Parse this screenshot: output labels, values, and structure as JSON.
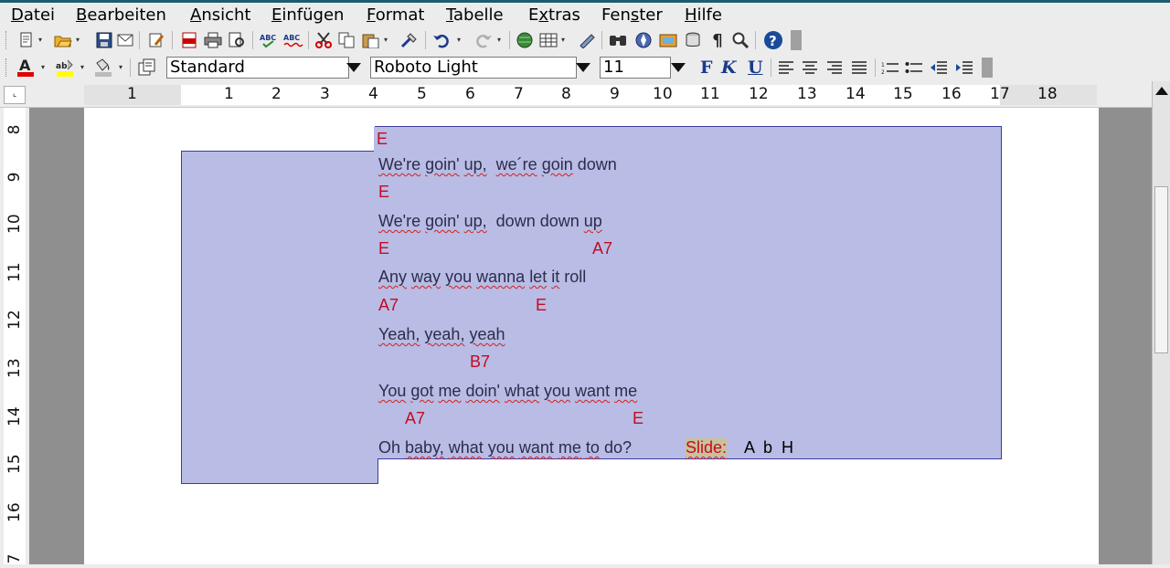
{
  "menubar": {
    "items": [
      {
        "pre": "",
        "ul": "D",
        "post": "atei"
      },
      {
        "pre": "",
        "ul": "B",
        "post": "earbeiten"
      },
      {
        "pre": "",
        "ul": "A",
        "post": "nsicht"
      },
      {
        "pre": "",
        "ul": "E",
        "post": "infügen"
      },
      {
        "pre": "",
        "ul": "F",
        "post": "ormat"
      },
      {
        "pre": "",
        "ul": "T",
        "post": "abelle"
      },
      {
        "pre": "E",
        "ul": "x",
        "post": "tras"
      },
      {
        "pre": "Fen",
        "ul": "s",
        "post": "ter"
      },
      {
        "pre": "",
        "ul": "H",
        "post": "ilfe"
      }
    ]
  },
  "formatting": {
    "style": "Standard",
    "font": "Roboto Light",
    "size": "11",
    "bold": "F",
    "italic": "K",
    "underline": "U"
  },
  "ruler": {
    "h_marks": [
      "1",
      "1",
      "2",
      "3",
      "4",
      "5",
      "6",
      "7",
      "8",
      "9",
      "10",
      "11",
      "12",
      "13",
      "14",
      "15",
      "16",
      "17",
      "18"
    ],
    "v_marks": [
      "8",
      "9",
      "10",
      "11",
      "12",
      "13",
      "14",
      "15",
      "16",
      "7"
    ]
  },
  "document": {
    "chords1": "E",
    "lyric1": [
      "We're",
      "goin'",
      "up,",
      "we´re",
      "goin",
      "down"
    ],
    "chords2": "E",
    "lyric2": [
      "We're",
      "goin'",
      "up,",
      "down",
      "down",
      "up"
    ],
    "chords3a": "E",
    "chords3b": "A7",
    "lyric3": [
      "Any",
      "way",
      "you",
      "wanna",
      "let",
      "it",
      "roll"
    ],
    "chords4a": "A7",
    "chords4b": "E",
    "lyric4": [
      "Yeah,",
      "yeah,",
      "yeah"
    ],
    "chords5": "B7",
    "lyric5": [
      "You",
      "got",
      "me",
      "doin'",
      "what",
      "you",
      "want",
      "me"
    ],
    "chords6a": "A7",
    "chords6b": "E",
    "lyric6": [
      "Oh",
      "baby,",
      "what",
      "you",
      "want",
      "me",
      "to",
      "do?"
    ],
    "slide_label": "Slide:",
    "slide_keys": "A  b  H"
  },
  "colors": {
    "selection": "#b9bce4",
    "chord": "#c40a24",
    "lyric": "#2c2c4c",
    "field": "#c8c29a"
  }
}
